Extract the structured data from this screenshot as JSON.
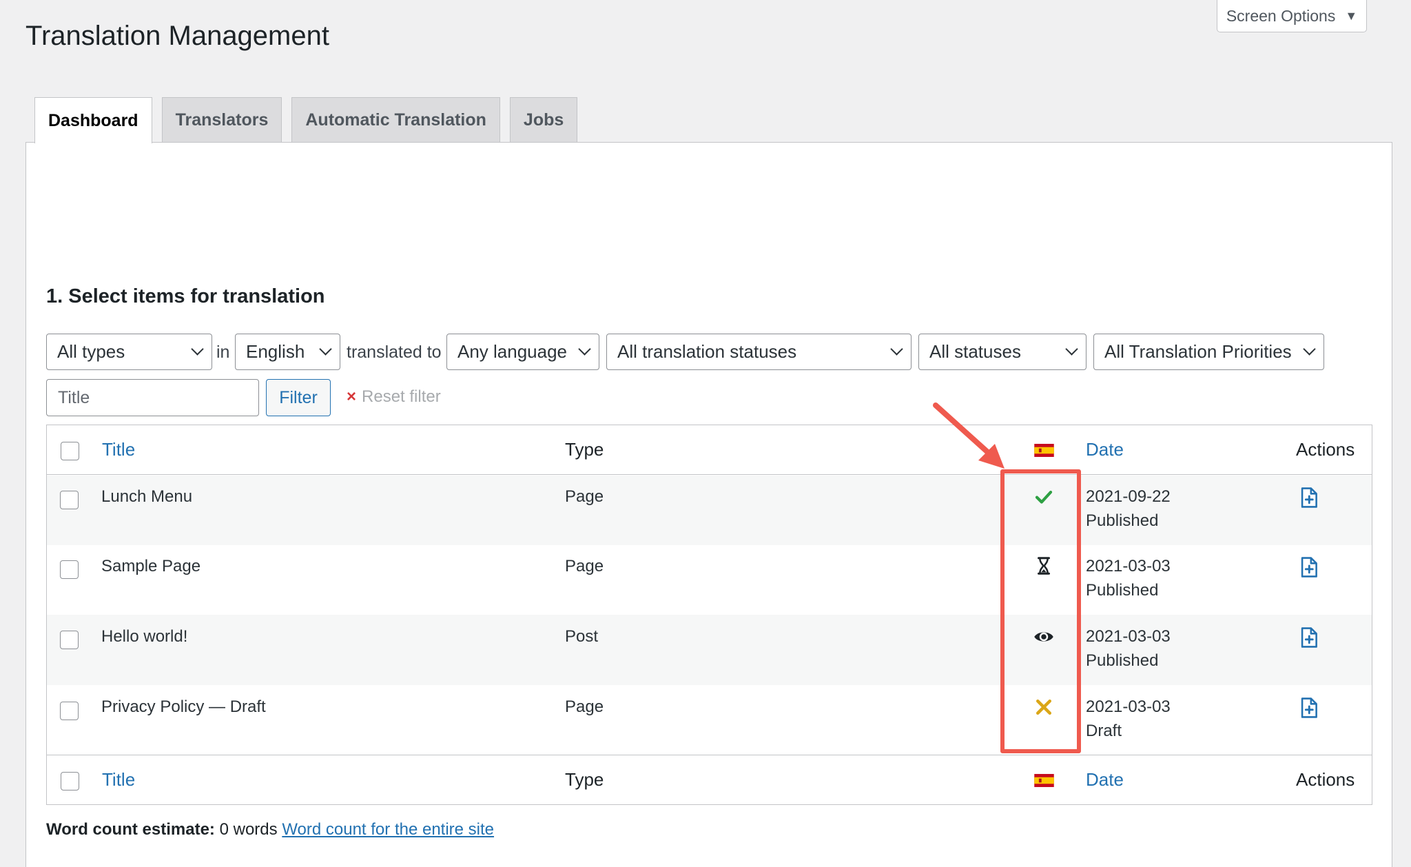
{
  "header": {
    "title": "Translation Management",
    "screen_options_label": "Screen Options",
    "screen_options_caret": "▼"
  },
  "tabs": [
    {
      "label": "Dashboard",
      "active": true
    },
    {
      "label": "Translators",
      "active": false
    },
    {
      "label": "Automatic Translation",
      "active": false
    },
    {
      "label": "Jobs",
      "active": false
    }
  ],
  "section": {
    "title": "1. Select items for translation"
  },
  "filters": {
    "type_select": "All types",
    "in_label": "in",
    "language_select": "English",
    "translated_to_label": "translated to",
    "target_language_select": "Any language",
    "translation_status_select": "All translation statuses",
    "status_select": "All statuses",
    "priority_select": "All Translation Priorities",
    "title_placeholder": "Title",
    "filter_button": "Filter",
    "reset_icon": "×",
    "reset_label": "Reset filter"
  },
  "table": {
    "columns": {
      "title": "Title",
      "type": "Type",
      "language_flag": "spain-flag-icon",
      "date": "Date",
      "actions": "Actions"
    },
    "rows": [
      {
        "title": "Lunch Menu",
        "type": "Page",
        "translation_status": "check-icon",
        "date": "2021-09-22",
        "status": "Published"
      },
      {
        "title": "Sample Page",
        "type": "Page",
        "translation_status": "hourglass-icon",
        "date": "2021-03-03",
        "status": "Published"
      },
      {
        "title": "Hello world!",
        "type": "Post",
        "translation_status": "eye-icon",
        "date": "2021-03-03",
        "status": "Published"
      },
      {
        "title": "Privacy Policy — Draft",
        "type": "Page",
        "translation_status": "x-icon",
        "date": "2021-03-03",
        "status": "Draft"
      }
    ]
  },
  "word_count": {
    "label": "Word count estimate:",
    "value": "0 words",
    "link": "Word count for the entire site"
  },
  "colors": {
    "link": "#2271b1",
    "check": "#2ea043",
    "cross": "#dba617",
    "annotation": "#ef5a4e"
  }
}
